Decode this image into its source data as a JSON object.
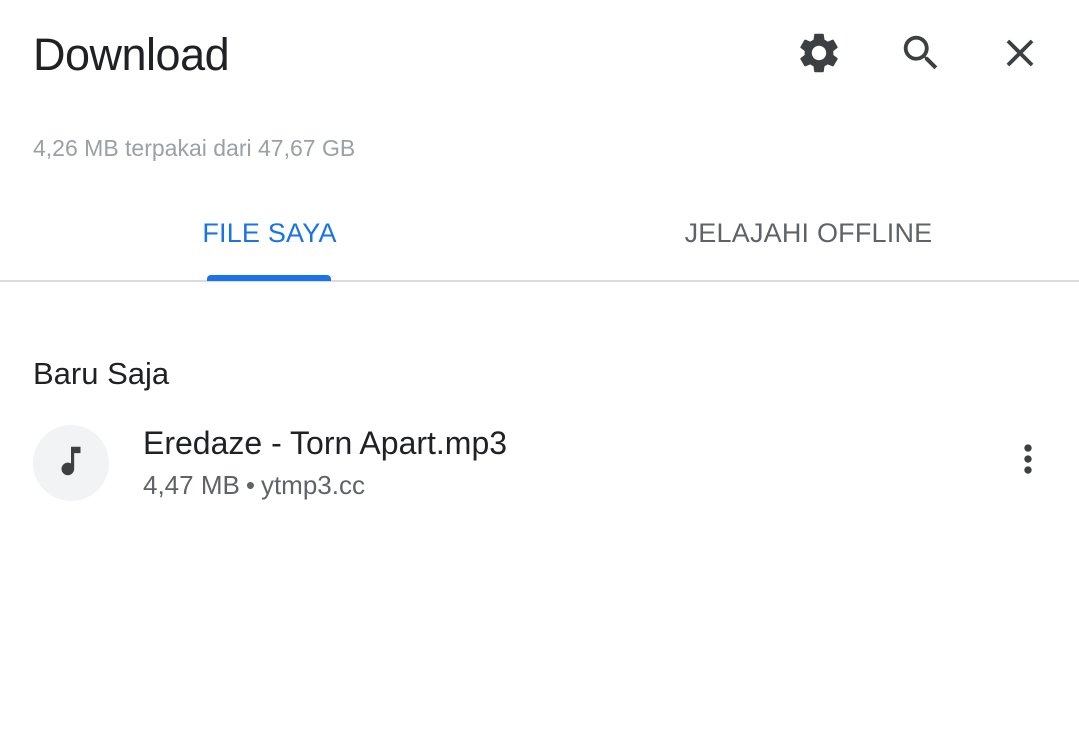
{
  "header": {
    "title": "Download",
    "icons": [
      "gear-icon",
      "search-icon",
      "close-icon"
    ]
  },
  "storage": {
    "text": "4,26 MB terpakai dari 47,67 GB"
  },
  "tabs": [
    {
      "label": "FILE SAYA",
      "active": true
    },
    {
      "label": "JELAJAHI OFFLINE",
      "active": false
    }
  ],
  "sections": [
    {
      "title": "Baru Saja",
      "items": [
        {
          "name": "Eredaze - Torn Apart.mp3",
          "size": "4,47 MB",
          "separator": "•",
          "source": "ytmp3.cc",
          "icon": "music-note-icon"
        }
      ]
    }
  ],
  "colors": {
    "accent": "#1a73e8",
    "text_primary": "#202124",
    "text_secondary": "#5f6368",
    "text_muted": "#9aa0a6",
    "icon": "#3c4043",
    "thumb_bg": "#f1f3f4",
    "divider": "#dadce0"
  }
}
